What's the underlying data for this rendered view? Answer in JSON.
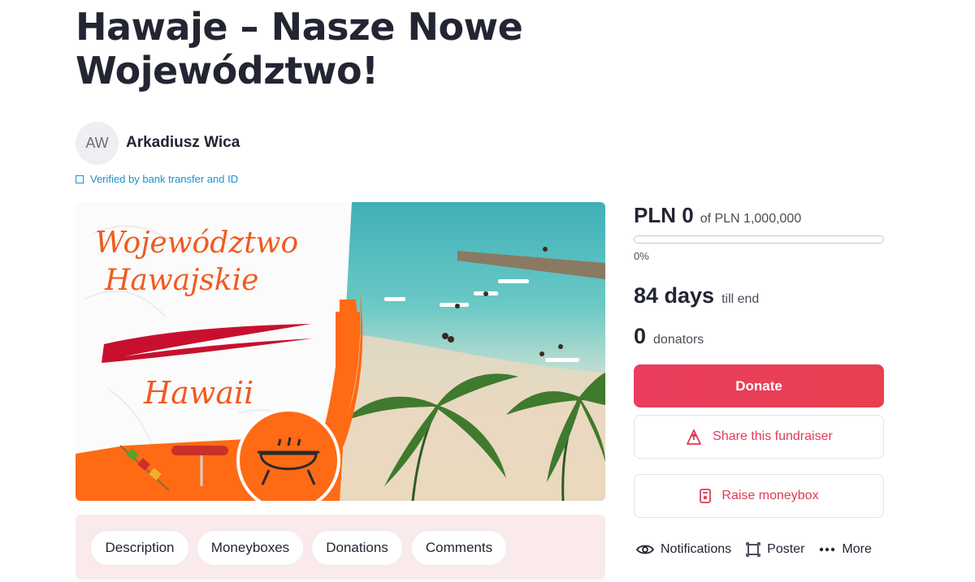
{
  "campaign": {
    "title": "Hawaje – Nasze Nowe Województwo!"
  },
  "author": {
    "initials": "AW",
    "name": "Arkadiusz Wica",
    "verified_text": "Verified by bank transfer and ID"
  },
  "hero": {
    "headline_line1": "Województwo",
    "headline_line2": "Hawajskie",
    "subline": "Hawaii"
  },
  "tabs": [
    "Description",
    "Moneyboxes",
    "Donations",
    "Comments"
  ],
  "stats": {
    "raised": "PLN 0",
    "goal": "of PLN 1,000,000",
    "progress_label": "0%",
    "progress_fraction": 0,
    "days": "84 days",
    "days_suffix": "till end",
    "donors": "0",
    "donors_suffix": "donators"
  },
  "buttons": {
    "donate": "Donate",
    "share": "Share this fundraiser",
    "moneybox": "Raise moneybox"
  },
  "actions": {
    "notifications": "Notifications",
    "poster": "Poster",
    "more": "More"
  },
  "colors": {
    "accent": "#e8395a",
    "link": "#1b8fcf",
    "tab_bar_bg": "#fbeaec"
  }
}
